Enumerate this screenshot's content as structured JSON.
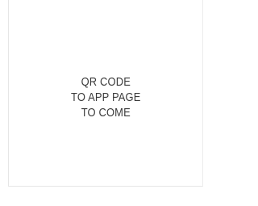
{
  "qr_placeholder": {
    "lines": [
      "QR CODE",
      "TO APP PAGE",
      "TO COME"
    ]
  }
}
